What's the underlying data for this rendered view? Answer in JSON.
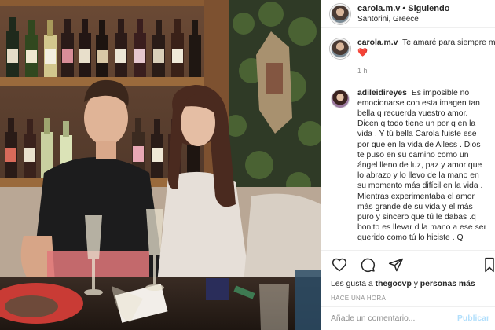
{
  "post": {
    "author": "carola.m.v",
    "separator": "•",
    "follow_label": "Siguiendo",
    "location": "Santorini, Greece"
  },
  "caption": {
    "username": "carola.m.v",
    "text": "Te amaré para siempre mi Puchum",
    "emoji": "❤️",
    "time": "1 h"
  },
  "comment": {
    "username": "adileidireyes",
    "text": "Es imposible no emocionarse con esta imagen tan bella q recuerda vuestro amor. Dicen q todo tiene un por q en la vida . Y tú bella Carola fuiste ese por que en la vida de Alless . Dios te puso en su camino como un ángel lleno de luz, paz y amor que lo abrazo y lo llevo de la mano en su momento más difícil en la vida . Mientras experimentaba el amor más grande de su vida y el más puro y sincero que tú le dabas .q bonito es llevar d la mano a ese ser querido como tú lo hiciste . Q"
  },
  "actions": {
    "icons": [
      "heart-icon",
      "comment-icon",
      "share-icon",
      "bookmark-icon"
    ],
    "likes_prefix": "Les gusta a",
    "likes_user": "thegocvp",
    "likes_and": "y",
    "likes_others": "personas más",
    "timestamp": "HACE UNA HORA"
  },
  "add_comment": {
    "placeholder": "Añade un comentario...",
    "publish_label": "Publicar"
  },
  "colors": {
    "heart": "#ed4956",
    "publish": "#b2dffc",
    "muted": "#8e8e8e"
  }
}
